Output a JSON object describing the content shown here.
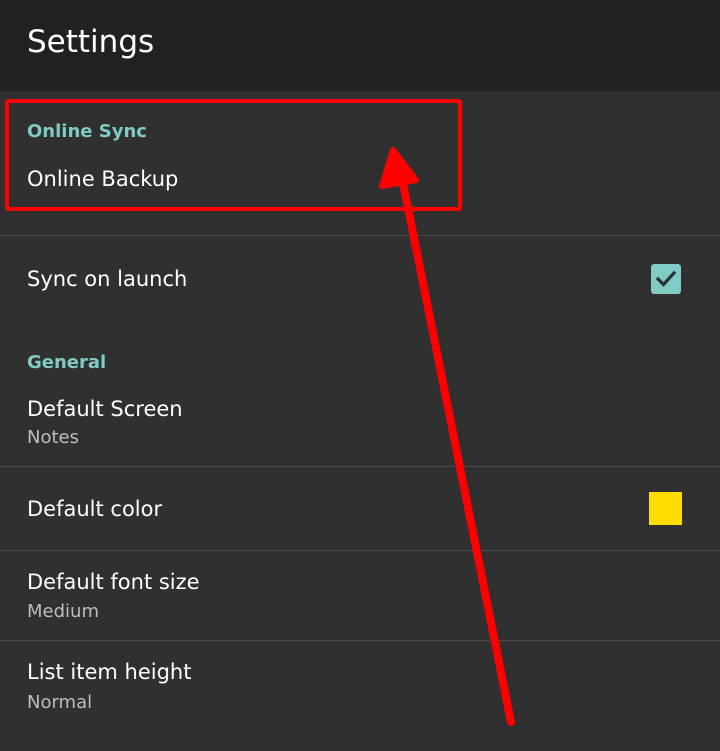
{
  "app": {
    "title": "Settings"
  },
  "sections": {
    "online_sync": {
      "header": "Online Sync",
      "online_backup": {
        "title": "Online Backup"
      },
      "sync_on_launch": {
        "title": "Sync on launch",
        "checked": true
      }
    },
    "general": {
      "header": "General",
      "default_screen": {
        "title": "Default Screen",
        "summary": "Notes"
      },
      "default_color": {
        "title": "Default color",
        "swatch_color": "#ffdd00"
      },
      "default_font_size": {
        "title": "Default font size",
        "summary": "Medium"
      },
      "list_item_height": {
        "title": "List item height",
        "summary": "Normal"
      }
    }
  },
  "colors": {
    "accent": "#80cbc4",
    "annotation": "#ff0000",
    "background": "#303030",
    "appbar": "#212121"
  },
  "icons": {
    "checkbox": "checkmark-icon",
    "annotation": "arrow-icon"
  }
}
